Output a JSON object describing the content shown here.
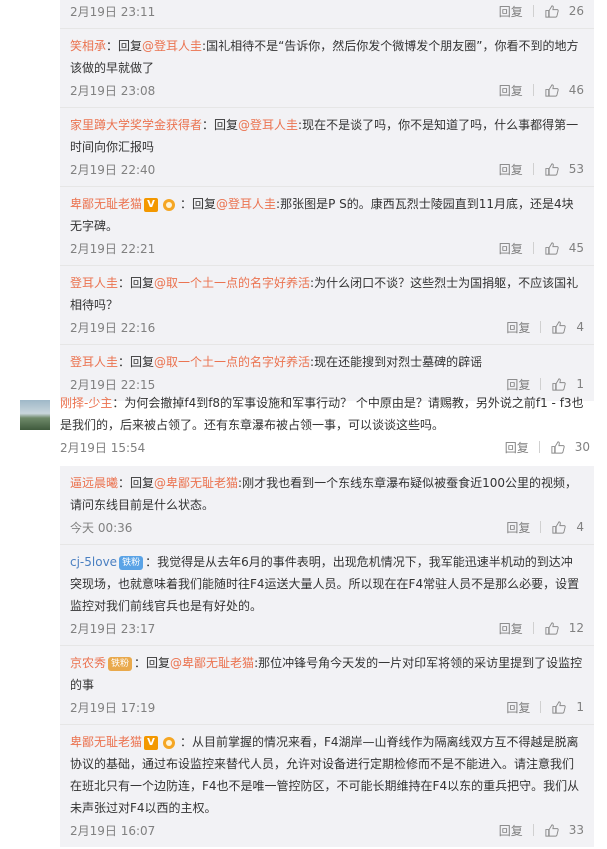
{
  "block1": {
    "replies": [
      {
        "user": "",
        "segments": [],
        "time": "2月19日 23:11",
        "reply_label": "回复",
        "likes": "26"
      },
      {
        "user": "笑相承",
        "prefix": "：回复",
        "at": "@登耳人圭",
        "content": ":国礼相待不是“告诉你，然后你发个微博发个朋友圈”，你看不到的地方该做的早就做了",
        "time": "2月19日 23:08",
        "reply_label": "回复",
        "likes": "46"
      },
      {
        "user": "家里蹲大学奖学金获得者",
        "prefix": "：回复",
        "at": "@登耳人圭",
        "content": ":现在不是谈了吗，你不是知道了吗，什么事都得第一时间向你汇报吗",
        "time": "2月19日 22:40",
        "reply_label": "回复",
        "likes": "53"
      },
      {
        "user": "卑鄙无耻老猫",
        "badge": "V",
        "prefix": "：回复",
        "at": "@登耳人圭",
        "content": ":那张图是P S的。康西瓦烈士陵园直到11月底，还是4块无字碑。",
        "time": "2月19日 22:21",
        "reply_label": "回复",
        "likes": "45"
      },
      {
        "user": "登耳人圭",
        "prefix": "：回复",
        "at": "@取一个土一点的名字好养活",
        "content": ":为什么闭口不谈？这些烈士为国捐躯，不应该国礼相待吗？",
        "time": "2月19日 22:16",
        "reply_label": "回复",
        "likes": "4"
      },
      {
        "user": "登耳人圭",
        "prefix": "：回复",
        "at": "@取一个土一点的名字好养活",
        "content": ":现在还能搜到对烈士墓碑的辟谣",
        "time": "2月19日 22:15",
        "reply_label": "回复",
        "likes": "1"
      }
    ]
  },
  "top_comment": {
    "user": "刚择-少主",
    "content": "：为何会撤掉f4到f8的军事设施和军事行动？ 个中原由是？请赐教，另外说之前f1 - f3也是我们的，后来被占领了。还有东章瀑布被占领一事，可以谈谈这些吗。",
    "time": "2月19日 15:54",
    "reply_label": "回复",
    "likes": "30"
  },
  "block2": {
    "replies": [
      {
        "user": "逼远晨曦",
        "prefix": "：回复",
        "at": "@卑鄙无耻老猫",
        "content": ":刚才我也看到一个东线东章瀑布疑似被蚕食近100公里的视频，请问东线目前是什么状态。",
        "time": "今天 00:36",
        "reply_label": "回复",
        "likes": "4"
      },
      {
        "user": "cj-5love",
        "pill": "铁粉",
        "content": "：我觉得是从去年6月的事件表明，出现危机情况下，我军能迅速半机动的到达冲突现场，也就意味着我们能随时往F4运送大量人员。所以现在在F4常驻人员不是那么必要，设置监控对我们前线官兵也是有好处的。",
        "time": "2月19日 23:17",
        "reply_label": "回复",
        "likes": "12"
      },
      {
        "user": "京农秀",
        "pill2": "铁粉",
        "prefix": "：回复",
        "at": "@卑鄙无耻老猫",
        "content": ":那位冲锋号角今天发的一片对印军将领的采访里提到了设监控的事",
        "time": "2月19日 17:19",
        "reply_label": "回复",
        "likes": "1"
      },
      {
        "user": "卑鄙无耻老猫",
        "badge": "V",
        "content": "：从目前掌握的情况来看，F4湖岸—山脊线作为隔离线双方互不得越是脱离协议的基础，通过布设监控来替代人员，允许对设备进行定期检修而不是不能进入。请注意我们在班北只有一个边防连，F4也不是唯一管控防区，不可能长期维持在F4以东的重兵把守。我们从未声张过对F4以西的主权。",
        "time": "2月19日 16:07",
        "reply_label": "回复",
        "likes": "33"
      }
    ]
  },
  "colors": {
    "accent": "#eb7350",
    "panel_bg": "#f2f2f5",
    "meta": "#808080"
  },
  "icons": {
    "like": "thumbs-up-icon",
    "avatar": "avatar-image"
  }
}
